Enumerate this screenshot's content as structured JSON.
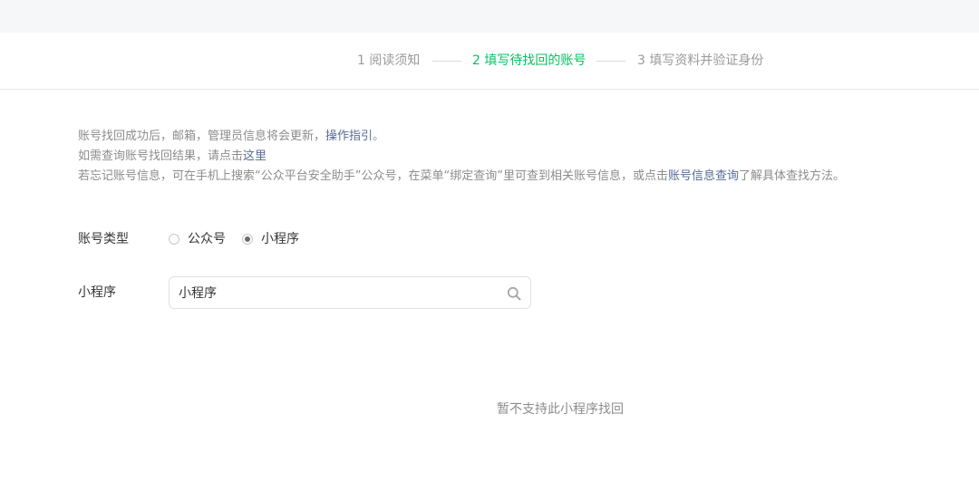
{
  "steps": [
    {
      "label": "1 阅读须知",
      "state": "done"
    },
    {
      "label": "2 填写待找回的账号",
      "state": "active"
    },
    {
      "label": "3 填写资料并验证身份",
      "state": "pending"
    }
  ],
  "notice": {
    "line1_text": "账号找回成功后，邮箱，管理员信息将会更新，",
    "line1_link": "操作指引",
    "line1_end": "。",
    "line2_text": "如需查询账号找回结果，请点击",
    "line2_link": "这里",
    "line3_text": "若忘记账号信息，可在手机上搜索“公众平台安全助手”公众号，在菜单“绑定查询”里可查到相关账号信息，或点击",
    "line3_link": "账号信息查询",
    "line3_end": "了解具体查找方法。"
  },
  "form": {
    "account_type_label": "账号类型",
    "options": [
      {
        "label": "公众号",
        "checked": false
      },
      {
        "label": "小程序",
        "checked": true
      }
    ],
    "miniprogram_label": "小程序",
    "search_value": "小程序"
  },
  "result_message": "暂不支持此小程序找回",
  "colors": {
    "accent": "#07c160",
    "link": "#576b95",
    "muted_text": "#8c8c8c",
    "top_bar": "#f6f7f9"
  },
  "icons": {
    "search": "magnifier"
  }
}
